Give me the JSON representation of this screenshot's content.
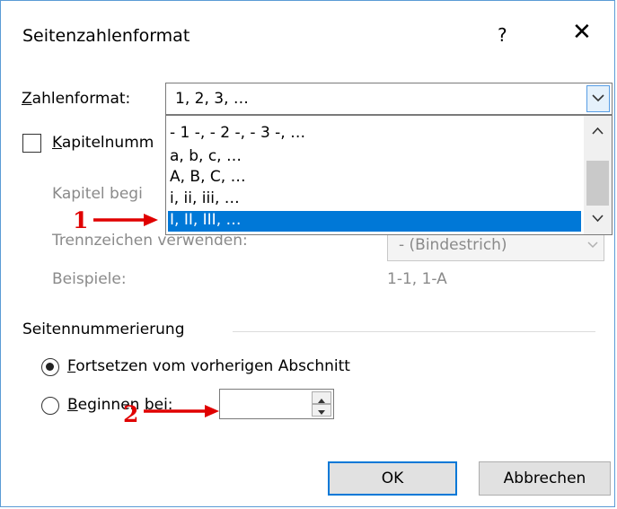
{
  "dialog": {
    "title": "Seitenzahlenformat",
    "help": "?",
    "close": "✕"
  },
  "format": {
    "label_prefix": "Z",
    "label_rest": "ahlenformat:",
    "value": "1, 2, 3, …",
    "options": [
      "- 1 -, - 2 -, - 3 -, …",
      "a, b, c, …",
      "A, B, C, …",
      "i, ii, iii, …",
      "I, II, III, …"
    ],
    "selected_index": 4
  },
  "chapter": {
    "checkbox_prefix": "K",
    "checkbox_rest": "apitelnumm",
    "starts_label": "Kapitel begi",
    "separator_label": "Trennzeichen verwenden:",
    "separator_value": "-    (Bindestrich)",
    "examples_label": "Beispiele:",
    "examples_value": "1-1, 1-A"
  },
  "numbering": {
    "group_label": "Seitennummerierung",
    "continue_prefix": "F",
    "continue_rest": "ortsetzen vom vorherigen Abschnitt",
    "start_prefix": "B",
    "start_rest": "eginnen bei:",
    "start_value": ""
  },
  "buttons": {
    "ok": "OK",
    "cancel": "Abbrechen"
  },
  "annotations": {
    "one": "1",
    "two": "2",
    "color": "#e00000"
  }
}
